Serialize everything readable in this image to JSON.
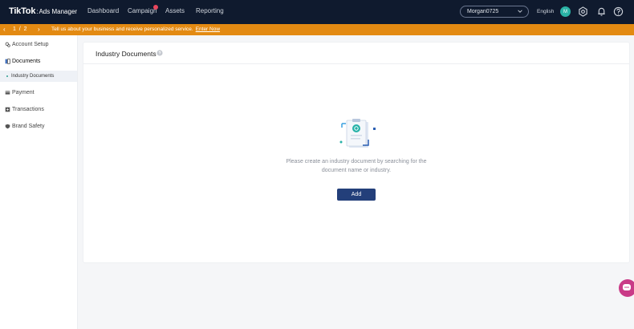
{
  "nav": {
    "brand": "TikTok",
    "sub": "Ads Manager",
    "items": [
      "Dashboard",
      "Campaign",
      "Assets",
      "Reporting"
    ],
    "account": "Morgan0725",
    "language": "English",
    "avatar_initial": "M"
  },
  "banner": {
    "page_current": "1",
    "page_sep": "/",
    "page_total": "2",
    "message": "Tell us about your business and receive personalized service.",
    "link": "Enter Now"
  },
  "sidebar": {
    "items": [
      {
        "label": "Account Setup",
        "icon": "account-setup-icon"
      },
      {
        "label": "Documents",
        "icon": "documents-icon"
      },
      {
        "label": "Payment",
        "icon": "payment-icon"
      },
      {
        "label": "Transactions",
        "icon": "transactions-icon"
      },
      {
        "label": "Brand Safety",
        "icon": "brand-safety-icon"
      }
    ],
    "sub_item": "Industry Documents"
  },
  "main": {
    "title": "Industry Documents",
    "empty_line1": "Please create an industry document by searching for the",
    "empty_line2": "document name or industry.",
    "add_button": "Add"
  },
  "colors": {
    "nav_bg": "#0f1a2e",
    "banner_bg": "#e38a12",
    "primary_button": "#233f7a",
    "chat_fab": "#c93a87",
    "avatar": "#2ab3a6"
  }
}
